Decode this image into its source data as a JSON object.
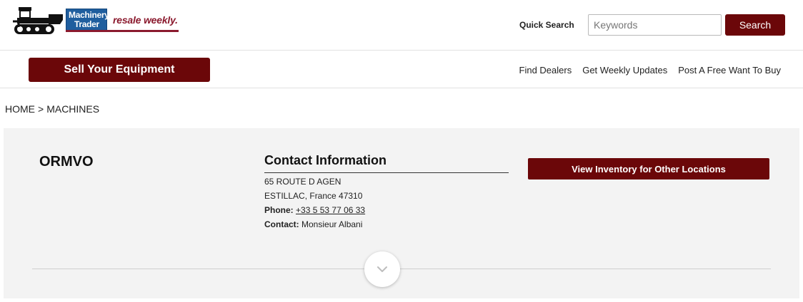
{
  "brand": {
    "logo_line1": "Machinery",
    "logo_line2": "Trader",
    "logo_tagline": "resale weekly."
  },
  "search": {
    "label": "Quick Search",
    "placeholder": "Keywords",
    "value": "",
    "button_label": "Search"
  },
  "nav": {
    "sell_label": "Sell Your Equipment",
    "links": [
      "Find Dealers",
      "Get Weekly Updates",
      "Post A Free Want To Buy"
    ]
  },
  "breadcrumb": {
    "items": [
      "HOME",
      "MACHINES"
    ],
    "separator": ">"
  },
  "dealer": {
    "name": "ORMVO",
    "contact_heading": "Contact Information",
    "address1": "65 ROUTE D AGEN",
    "address2": "ESTILLAC, France 47310",
    "phone_label": "Phone:",
    "phone": "+33 5 53 77 06 33",
    "contact_label": "Contact:",
    "contact_name": "Monsieur Albani",
    "inventory_button": "View Inventory for Other Locations"
  },
  "colors": {
    "brand_red": "#6b0709",
    "logo_blue": "#1f5e9e",
    "tagline_red": "#8b1a2e",
    "panel_bg": "#f3f3f3"
  },
  "icons": {
    "logo": "bulldozer-icon",
    "expand": "chevron-down-icon"
  }
}
